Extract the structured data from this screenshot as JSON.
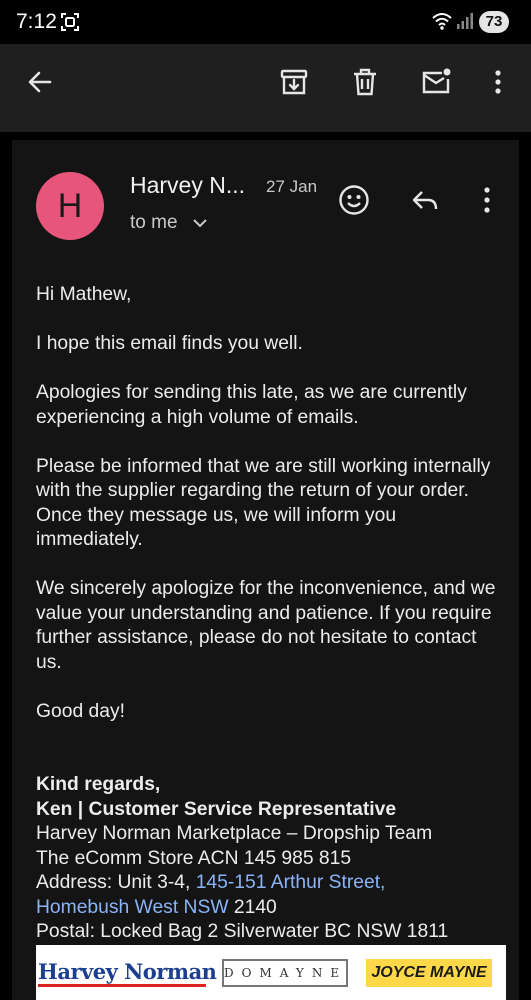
{
  "status_bar": {
    "time": "7:12",
    "battery": "73"
  },
  "app_bar": {
    "back_icon": "arrow-left-icon",
    "archive_icon": "archive-icon",
    "delete_icon": "trash-icon",
    "mark_unread_icon": "mail-unread-icon",
    "more_icon": "more-vert-icon"
  },
  "email": {
    "avatar_letter": "H",
    "avatar_color": "#e8557a",
    "sender": "Harvey N...",
    "date": "27 Jan",
    "recipient": "to me",
    "greeting": "Hi Mathew,",
    "paragraphs": [
      "I hope this email finds you well.",
      "Apologies for sending this late, as we are currently experiencing a high volume of emails.",
      "Please be informed that we are still working internally with the supplier regarding the return of your order. Once they message us, we will inform you immediately.",
      "We sincerely apologize for the inconvenience, and we value your understanding and patience. If you require further assistance, please do not hesitate to contact us.",
      "Good day!"
    ],
    "signature": {
      "regards": "Kind regards,",
      "name_title": "Ken | Customer Service Representative",
      "team": "Harvey Norman Marketplace – Dropship Team",
      "company": "The eComm Store ACN 145 985 815",
      "address_prefix": "Address: Unit 3-4, ",
      "address_link_1": "145-151 Arthur Street,",
      "address_link_2": "Homebush West NSW",
      "address_postcode": " 2140",
      "postal": "Postal: Locked Bag 2 Silverwater BC NSW 1811"
    },
    "logos": {
      "harvey_norman": "Harvey Norman",
      "domayne": "DOMAYNE",
      "joyce_mayne": "JOYCE MAYNE"
    }
  }
}
